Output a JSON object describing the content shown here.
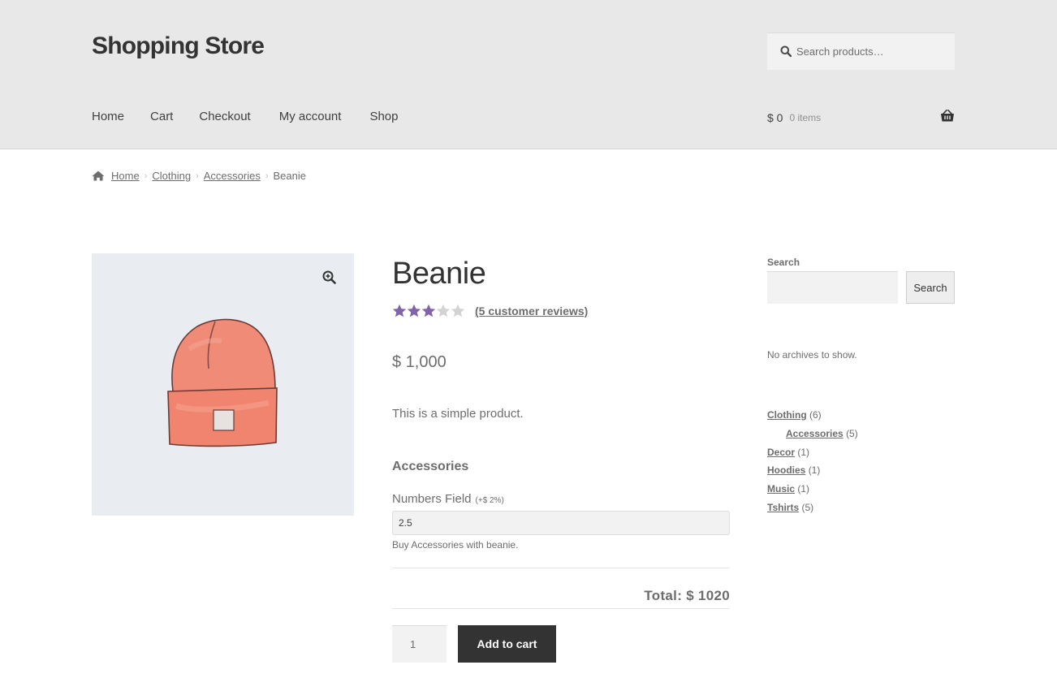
{
  "header": {
    "site_title": "Shopping Store",
    "search_placeholder": "Search products…",
    "nav": [
      "Home",
      "Cart",
      "Checkout",
      "My account",
      "Shop"
    ],
    "cart_amount": "$ 0",
    "cart_count": "0 items",
    "bg_color": "#e8e8e8"
  },
  "breadcrumb": {
    "items": [
      "Home",
      "Clothing",
      "Accessories"
    ],
    "current": "Beanie"
  },
  "product": {
    "title": "Beanie",
    "rating": 3.5,
    "rating_max": 5,
    "reviews_link": "(5 customer reviews)",
    "price": "$ 1,000",
    "short_description": "This is a simple product.",
    "image": "beanie-image",
    "star_color": "#8064aa"
  },
  "addon": {
    "heading": "Accessories",
    "field_label": "Numbers Field",
    "price_hint": "(+$ 2%)",
    "field_value": "2.5",
    "field_description": "Buy Accessories with beanie.",
    "total": "Total: $ 1020"
  },
  "purchase": {
    "quantity": "1",
    "add_to_cart_label": "Add to cart",
    "button_color": "#333333"
  },
  "sidebar": {
    "search_label": "Search",
    "search_button": "Search",
    "no_archives": "No archives to show.",
    "categories": [
      {
        "name": "Clothing",
        "count": "(6)"
      },
      {
        "name": "Accessories",
        "count": "(5)"
      },
      {
        "name": "Decor",
        "count": "(1)"
      },
      {
        "name": "Hoodies",
        "count": "(1)"
      },
      {
        "name": "Music",
        "count": "(1)"
      },
      {
        "name": "Tshirts",
        "count": "(5)"
      }
    ]
  }
}
